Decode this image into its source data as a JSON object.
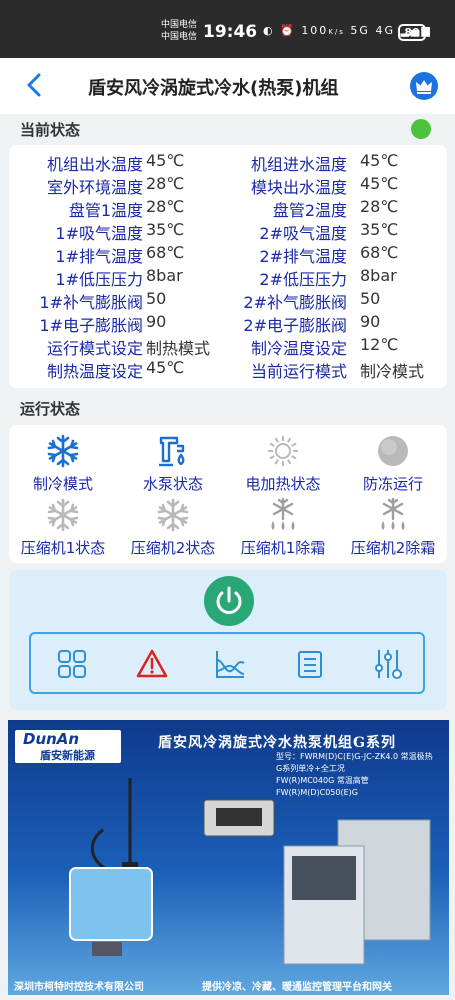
{
  "status_bar": {
    "carrier1": "中国电信",
    "carrier2": "中国电信",
    "time": "19:46",
    "net_speed_top": "100",
    "net_speed_unit": "K/s",
    "signal_text": "5G 4G",
    "battery": "80"
  },
  "header": {
    "title": "盾安风冷涡旋式冷水(热泵)机组"
  },
  "current_status": {
    "label": "当前状态",
    "online_color": "#4cc23b",
    "rows": [
      [
        "机组出水温度",
        "45℃",
        "机组进水温度",
        "45℃"
      ],
      [
        "室外环境温度",
        "28℃",
        "模块出水温度",
        "45℃"
      ],
      [
        "盘管1温度",
        "28℃",
        "盘管2温度",
        "28℃"
      ],
      [
        "1#吸气温度",
        "35℃",
        "2#吸气温度",
        "35℃"
      ],
      [
        "1#排气温度",
        "68℃",
        "2#排气温度",
        "68℃"
      ],
      [
        "1#低压压力",
        "8bar",
        "2#低压压力",
        "8bar"
      ],
      [
        "1#补气膨胀阀",
        "50",
        "2#补气膨胀阀",
        "50"
      ],
      [
        "1#电子膨胀阀",
        "90",
        "2#电子膨胀阀",
        "90"
      ],
      [
        "运行模式设定",
        "制热模式",
        "制冷温度设定",
        "12℃"
      ],
      [
        "制热温度设定",
        "45℃",
        "当前运行模式",
        "制冷模式"
      ]
    ]
  },
  "run_status": {
    "label": "运行状态",
    "items": [
      {
        "label": "制冷模式",
        "icon": "snowflake-icon",
        "color": "#1a6fd0"
      },
      {
        "label": "水泵状态",
        "icon": "water-pump-icon",
        "color": "#1a6fd0"
      },
      {
        "label": "电加热状态",
        "icon": "sun-icon",
        "color": "#b9b9b9"
      },
      {
        "label": "防冻运行",
        "icon": "antifreeze-icon",
        "color": "#b9b9b9"
      },
      {
        "label": "压缩机1状态",
        "icon": "snowflake-icon",
        "color": "#b9b9b9"
      },
      {
        "label": "压缩机2状态",
        "icon": "snowflake-icon",
        "color": "#b9b9b9"
      },
      {
        "label": "压缩机1除霜",
        "icon": "defrost-icon",
        "color": "#9e9e9e"
      },
      {
        "label": "压缩机2除霜",
        "icon": "defrost-icon",
        "color": "#9e9e9e"
      }
    ]
  },
  "controls": {
    "power_icon": "power-icon",
    "tools": [
      "grid-icon",
      "alarm-icon",
      "chart-icon",
      "list-icon",
      "settings-sliders-icon"
    ]
  },
  "banner": {
    "logo_en": "DunAn",
    "logo_cn": "盾安新能源",
    "title": "盾安风冷涡旋式冷水热泵机组G系列",
    "models": "型号：FWRM(D)C(E)G-JC-ZK4.0 常温极热\nG系列单冷+全工况\nFW(R)MC040G 常温高管\nFW(R)M(D)C050(E)G",
    "company": "深圳市柯特时控技术有限公司",
    "slogan": "提供冷凉、冷藏、暖通监控管理平台和网关"
  }
}
